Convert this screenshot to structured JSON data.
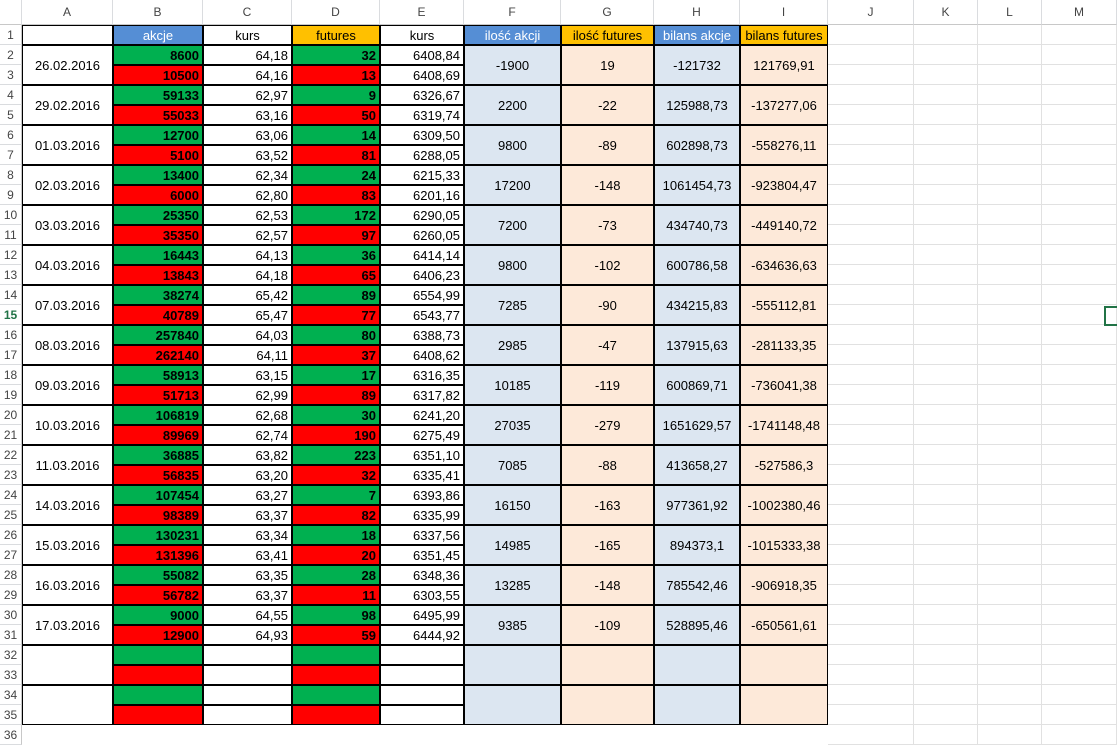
{
  "columns": [
    "A",
    "B",
    "C",
    "D",
    "E",
    "F",
    "G",
    "H",
    "I",
    "J",
    "K",
    "L",
    "M"
  ],
  "row_numbers": [
    "1",
    "2",
    "3",
    "4",
    "5",
    "6",
    "7",
    "8",
    "9",
    "10",
    "11",
    "12",
    "13",
    "14",
    "15",
    "16",
    "17",
    "18",
    "19",
    "20",
    "21",
    "22",
    "23",
    "24",
    "25",
    "26",
    "27",
    "28",
    "29",
    "30",
    "31",
    "32",
    "33",
    "34",
    "35",
    "36"
  ],
  "headers": {
    "B": "akcje",
    "C": "kurs",
    "D": "futures",
    "E": "kurs",
    "F": "ilość akcji",
    "G": "ilość futures",
    "H": "bilans akcje",
    "I": "bilans futures"
  },
  "groups": [
    {
      "date": "26.02.2016",
      "rows": [
        {
          "akcje": "8600",
          "kurs": "64,18",
          "futures": "32",
          "kurs2": "6408,84"
        },
        {
          "akcje": "10500",
          "kurs": "64,16",
          "futures": "13",
          "kurs2": "6408,69"
        }
      ],
      "ilosc_akcji": "-1900",
      "ilosc_futures": "19",
      "bilans_akcje": "-121732",
      "bilans_futures": "121769,91"
    },
    {
      "date": "29.02.2016",
      "rows": [
        {
          "akcje": "59133",
          "kurs": "62,97",
          "futures": "9",
          "kurs2": "6326,67"
        },
        {
          "akcje": "55033",
          "kurs": "63,16",
          "futures": "50",
          "kurs2": "6319,74"
        }
      ],
      "ilosc_akcji": "2200",
      "ilosc_futures": "-22",
      "bilans_akcje": "125988,73",
      "bilans_futures": "-137277,06"
    },
    {
      "date": "01.03.2016",
      "rows": [
        {
          "akcje": "12700",
          "kurs": "63,06",
          "futures": "14",
          "kurs2": "6309,50"
        },
        {
          "akcje": "5100",
          "kurs": "63,52",
          "futures": "81",
          "kurs2": "6288,05"
        }
      ],
      "ilosc_akcji": "9800",
      "ilosc_futures": "-89",
      "bilans_akcje": "602898,73",
      "bilans_futures": "-558276,11"
    },
    {
      "date": "02.03.2016",
      "rows": [
        {
          "akcje": "13400",
          "kurs": "62,34",
          "futures": "24",
          "kurs2": "6215,33"
        },
        {
          "akcje": "6000",
          "kurs": "62,80",
          "futures": "83",
          "kurs2": "6201,16"
        }
      ],
      "ilosc_akcji": "17200",
      "ilosc_futures": "-148",
      "bilans_akcje": "1061454,73",
      "bilans_futures": "-923804,47"
    },
    {
      "date": "03.03.2016",
      "rows": [
        {
          "akcje": "25350",
          "kurs": "62,53",
          "futures": "172",
          "kurs2": "6290,05"
        },
        {
          "akcje": "35350",
          "kurs": "62,57",
          "futures": "97",
          "kurs2": "6260,05"
        }
      ],
      "ilosc_akcji": "7200",
      "ilosc_futures": "-73",
      "bilans_akcje": "434740,73",
      "bilans_futures": "-449140,72"
    },
    {
      "date": "04.03.2016",
      "rows": [
        {
          "akcje": "16443",
          "kurs": "64,13",
          "futures": "36",
          "kurs2": "6414,14"
        },
        {
          "akcje": "13843",
          "kurs": "64,18",
          "futures": "65",
          "kurs2": "6406,23"
        }
      ],
      "ilosc_akcji": "9800",
      "ilosc_futures": "-102",
      "bilans_akcje": "600786,58",
      "bilans_futures": "-634636,63"
    },
    {
      "date": "07.03.2016",
      "rows": [
        {
          "akcje": "38274",
          "kurs": "65,42",
          "futures": "89",
          "kurs2": "6554,99"
        },
        {
          "akcje": "40789",
          "kurs": "65,47",
          "futures": "77",
          "kurs2": "6543,77"
        }
      ],
      "ilosc_akcji": "7285",
      "ilosc_futures": "-90",
      "bilans_akcje": "434215,83",
      "bilans_futures": "-555112,81"
    },
    {
      "date": "08.03.2016",
      "rows": [
        {
          "akcje": "257840",
          "kurs": "64,03",
          "futures": "80",
          "kurs2": "6388,73"
        },
        {
          "akcje": "262140",
          "kurs": "64,11",
          "futures": "37",
          "kurs2": "6408,62"
        }
      ],
      "ilosc_akcji": "2985",
      "ilosc_futures": "-47",
      "bilans_akcje": "137915,63",
      "bilans_futures": "-281133,35"
    },
    {
      "date": "09.03.2016",
      "rows": [
        {
          "akcje": "58913",
          "kurs": "63,15",
          "futures": "17",
          "kurs2": "6316,35"
        },
        {
          "akcje": "51713",
          "kurs": "62,99",
          "futures": "89",
          "kurs2": "6317,82"
        }
      ],
      "ilosc_akcji": "10185",
      "ilosc_futures": "-119",
      "bilans_akcje": "600869,71",
      "bilans_futures": "-736041,38"
    },
    {
      "date": "10.03.2016",
      "rows": [
        {
          "akcje": "106819",
          "kurs": "62,68",
          "futures": "30",
          "kurs2": "6241,20"
        },
        {
          "akcje": "89969",
          "kurs": "62,74",
          "futures": "190",
          "kurs2": "6275,49"
        }
      ],
      "ilosc_akcji": "27035",
      "ilosc_futures": "-279",
      "bilans_akcje": "1651629,57",
      "bilans_futures": "-1741148,48"
    },
    {
      "date": "11.03.2016",
      "rows": [
        {
          "akcje": "36885",
          "kurs": "63,82",
          "futures": "223",
          "kurs2": "6351,10"
        },
        {
          "akcje": "56835",
          "kurs": "63,20",
          "futures": "32",
          "kurs2": "6335,41"
        }
      ],
      "ilosc_akcji": "7085",
      "ilosc_futures": "-88",
      "bilans_akcje": "413658,27",
      "bilans_futures": "-527586,3"
    },
    {
      "date": "14.03.2016",
      "rows": [
        {
          "akcje": "107454",
          "kurs": "63,27",
          "futures": "7",
          "kurs2": "6393,86"
        },
        {
          "akcje": "98389",
          "kurs": "63,37",
          "futures": "82",
          "kurs2": "6335,99"
        }
      ],
      "ilosc_akcji": "16150",
      "ilosc_futures": "-163",
      "bilans_akcje": "977361,92",
      "bilans_futures": "-1002380,46"
    },
    {
      "date": "15.03.2016",
      "rows": [
        {
          "akcje": "130231",
          "kurs": "63,34",
          "futures": "18",
          "kurs2": "6337,56"
        },
        {
          "akcje": "131396",
          "kurs": "63,41",
          "futures": "20",
          "kurs2": "6351,45"
        }
      ],
      "ilosc_akcji": "14985",
      "ilosc_futures": "-165",
      "bilans_akcje": "894373,1",
      "bilans_futures": "-1015333,38"
    },
    {
      "date": "16.03.2016",
      "rows": [
        {
          "akcje": "55082",
          "kurs": "63,35",
          "futures": "28",
          "kurs2": "6348,36"
        },
        {
          "akcje": "56782",
          "kurs": "63,37",
          "futures": "11",
          "kurs2": "6303,55"
        }
      ],
      "ilosc_akcji": "13285",
      "ilosc_futures": "-148",
      "bilans_akcje": "785542,46",
      "bilans_futures": "-906918,35"
    },
    {
      "date": "17.03.2016",
      "rows": [
        {
          "akcje": "9000",
          "kurs": "64,55",
          "futures": "98",
          "kurs2": "6495,99"
        },
        {
          "akcje": "12900",
          "kurs": "64,93",
          "futures": "59",
          "kurs2": "6444,92"
        }
      ],
      "ilosc_akcji": "9385",
      "ilosc_futures": "-109",
      "bilans_akcje": "528895,46",
      "bilans_futures": "-650561,61"
    },
    {
      "date": "",
      "rows": [
        {
          "akcje": "",
          "kurs": "",
          "futures": "",
          "kurs2": ""
        },
        {
          "akcje": "",
          "kurs": "",
          "futures": "",
          "kurs2": ""
        }
      ],
      "ilosc_akcji": "",
      "ilosc_futures": "",
      "bilans_akcje": "",
      "bilans_futures": ""
    },
    {
      "date": "",
      "rows": [
        {
          "akcje": "",
          "kurs": "",
          "futures": "",
          "kurs2": ""
        },
        {
          "akcje": "",
          "kurs": "",
          "futures": "",
          "kurs2": ""
        }
      ],
      "ilosc_akcji": "",
      "ilosc_futures": "",
      "bilans_akcje": "",
      "bilans_futures": ""
    }
  ],
  "colors": {
    "buy": "#00b050",
    "sell": "#ff0000",
    "blue_header": "#558ed5",
    "orange_header": "#ffc000",
    "blue_fill": "#dce6f1",
    "peach_fill": "#fde9d9",
    "selection": "#217346"
  }
}
